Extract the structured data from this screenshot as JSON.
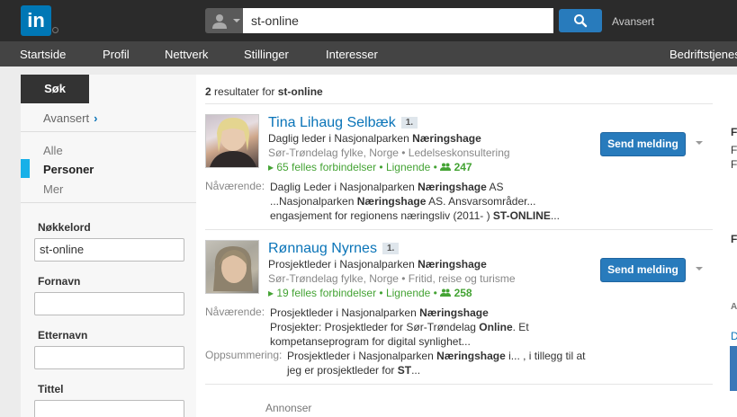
{
  "brand": {
    "logo_text": "in",
    "color": "#0077b5"
  },
  "search": {
    "value": "st-online",
    "advanced_label": "Avansert"
  },
  "nav": [
    "Startside",
    "Profil",
    "Nettverk",
    "Stillinger",
    "Interesser",
    "Bedriftstjenes"
  ],
  "sidebar": {
    "search_tab": "Søk",
    "advanced_link": "Avansert",
    "filters": [
      "Alle",
      "Personer",
      "Mer"
    ],
    "active_filter": "Personer",
    "fields": [
      {
        "label": "Nøkkelord",
        "value": "st-online"
      },
      {
        "label": "Fornavn",
        "value": ""
      },
      {
        "label": "Etternavn",
        "value": ""
      },
      {
        "label": "Tittel",
        "value": ""
      }
    ]
  },
  "results": {
    "count": "2",
    "summary_text": "resultater for",
    "query": "st-online",
    "items": [
      {
        "name": "Tina Lihaug Selbæk",
        "degree": "1.",
        "headline_pre": "Daglig leder i Nasjonalparken ",
        "headline_bold": "Næringshage",
        "location": "Sør-Trøndelag fylke, Norge • Ledelseskonsultering",
        "connections": "65 felles forbindelser • Lignende • ",
        "network_count": "247",
        "action": "Send melding",
        "snippet_label": "Nåværende:",
        "snippet": [
          {
            "pre": "Daglig Leder i Nasjonalparken ",
            "bold": "Næringshage",
            "post": " AS"
          },
          {
            "pre": "...Nasjonalparken ",
            "bold": "Næringshage",
            "post": " AS. Ansvarsområder..."
          },
          {
            "pre": "engasjement for regionens næringsliv (2011- ) ",
            "bold": "ST-ONLINE",
            "post": "..."
          }
        ]
      },
      {
        "name": "Rønnaug Nyrnes",
        "degree": "1.",
        "headline_pre": "Prosjektleder i Nasjonalparken ",
        "headline_bold": "Næringshage",
        "location": "Sør-Trøndelag fylke, Norge • Fritid, reise og turisme",
        "connections": "19 felles forbindelser • Lignende • ",
        "network_count": "258",
        "action": "Send melding",
        "snippet_label": "Nåværende:",
        "snippet": [
          {
            "pre": "Prosjektleder i Nasjonalparken ",
            "bold": "Næringshage",
            "post": ""
          },
          {
            "pre": "Prosjekter: Prosjektleder for Sør-Trøndelag ",
            "bold": "Online",
            "post": ". Et"
          },
          {
            "pre": "kompetanseprogram for digital synlighet...",
            "bold": "",
            "post": ""
          }
        ],
        "summary_label": "Oppsummering:",
        "summary": [
          {
            "pre": "Prosjektleder i Nasjonalparken ",
            "bold": "Næringshage",
            "post": " i... , i tillegg til at"
          },
          {
            "pre": "jeg er prosjektleder for ",
            "bold": "ST",
            "post": "..."
          }
        ]
      }
    ]
  },
  "ads_label": "Annonser",
  "right_panel": {
    "fragments": [
      "F",
      "F",
      "F",
      "F",
      "A",
      "D"
    ]
  }
}
